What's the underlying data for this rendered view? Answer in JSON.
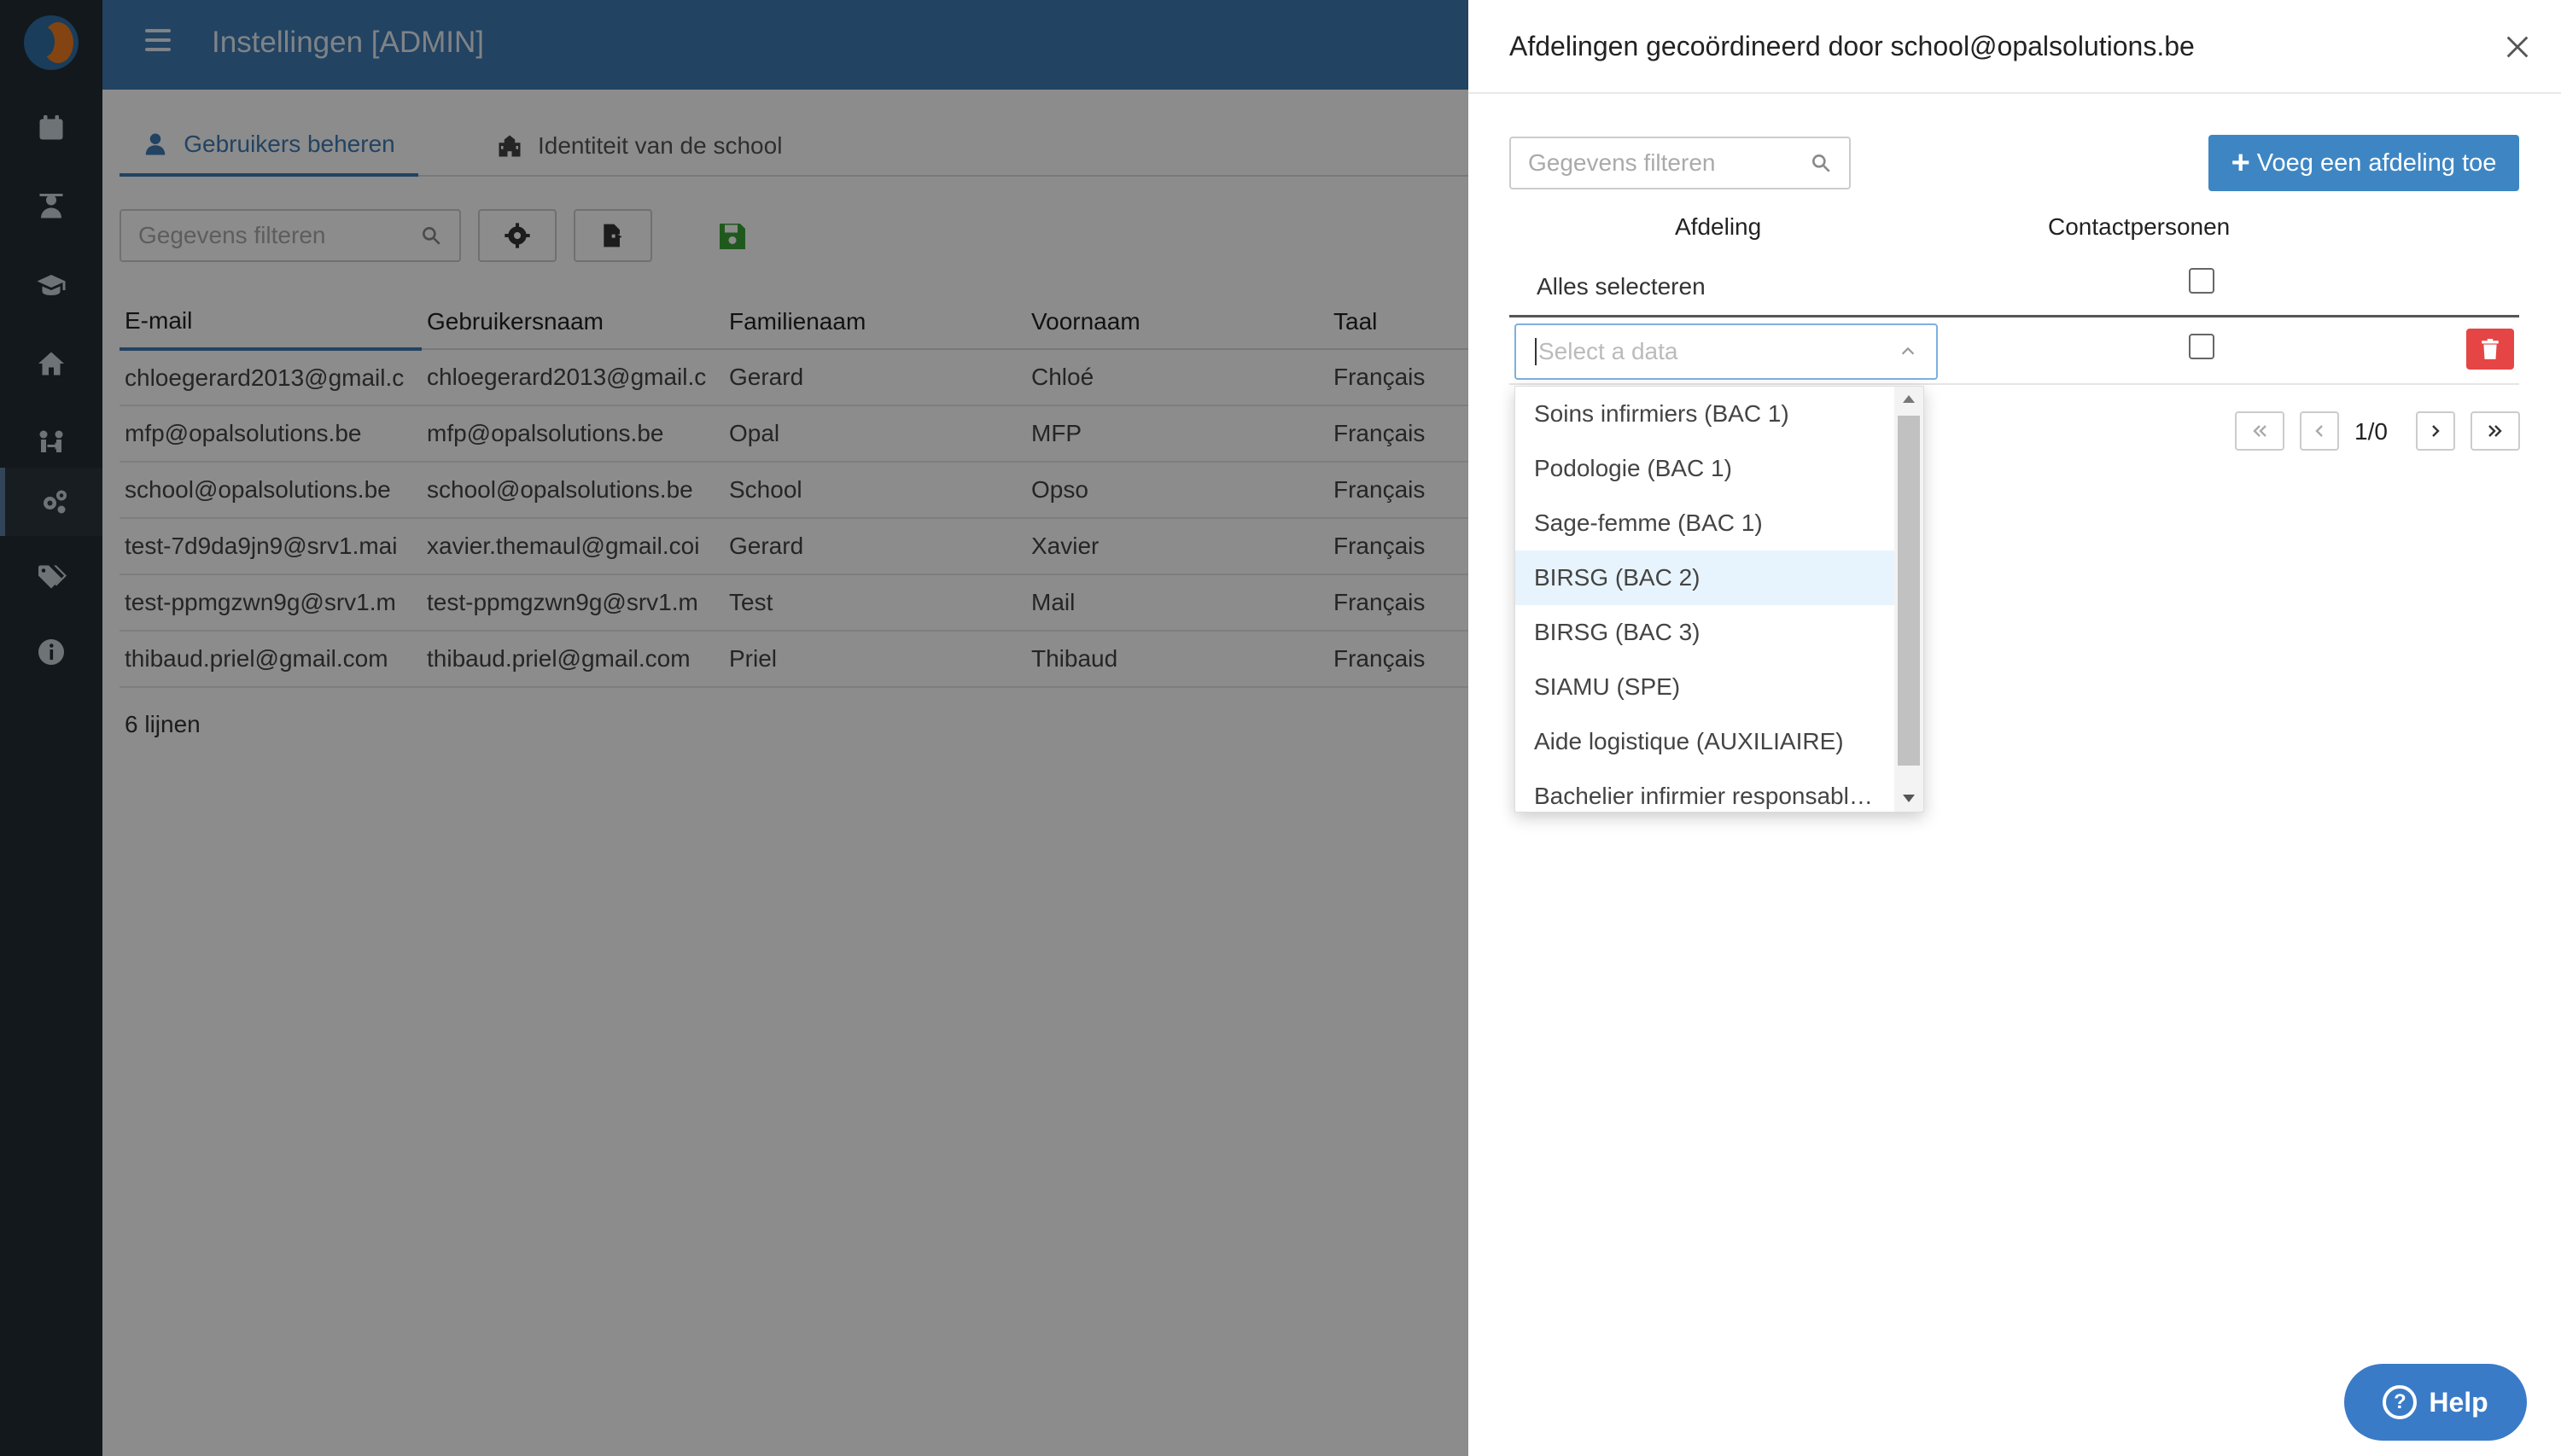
{
  "sidebar": {
    "items": [
      {
        "icon": "calendar-icon"
      },
      {
        "icon": "teacher-icon"
      },
      {
        "icon": "graduation-cap-icon"
      },
      {
        "icon": "home-icon"
      },
      {
        "icon": "users-exchange-icon"
      },
      {
        "icon": "gears-icon",
        "active": true
      },
      {
        "icon": "tags-icon"
      },
      {
        "icon": "info-icon"
      }
    ]
  },
  "header": {
    "title": "Instellingen [ADMIN]"
  },
  "tabs": [
    {
      "label": "Gebruikers beheren",
      "active": true
    },
    {
      "label": "Identiteit van de school",
      "active": false
    }
  ],
  "toolbar": {
    "filter_placeholder": "Gegevens filteren"
  },
  "table": {
    "headers": [
      "E-mail",
      "Gebruikersnaam",
      "Familienaam",
      "Voornaam",
      "Taal"
    ],
    "rows": [
      [
        "chloegerard2013@gmail.c",
        "chloegerard2013@gmail.c",
        "Gerard",
        "Chloé",
        "Français"
      ],
      [
        "mfp@opalsolutions.be",
        "mfp@opalsolutions.be",
        "Opal",
        "MFP",
        "Français"
      ],
      [
        "school@opalsolutions.be",
        "school@opalsolutions.be",
        "School",
        "Opso",
        "Français"
      ],
      [
        "test-7d9da9jn9@srv1.mai",
        "xavier.themaul@gmail.coi",
        "Gerard",
        "Xavier",
        "Français"
      ],
      [
        "test-ppmgzwn9g@srv1.m",
        "test-ppmgzwn9g@srv1.m",
        "Test",
        "Mail",
        "Français"
      ],
      [
        "thibaud.priel@gmail.com",
        "thibaud.priel@gmail.com",
        "Priel",
        "Thibaud",
        "Français"
      ]
    ],
    "count_label": "6 lijnen"
  },
  "drawer": {
    "title": "Afdelingen gecoördineerd door school@opalsolutions.be",
    "filter_placeholder": "Gegevens filteren",
    "add_button": "Voeg een afdeling toe",
    "col_afdeling": "Afdeling",
    "col_contact": "Contactpersonen",
    "select_all": "Alles selecteren",
    "select_placeholder": "Select a data",
    "pager_text": "1/0"
  },
  "dropdown": {
    "options": [
      "Soins infirmiers (BAC 1)",
      "Podologie (BAC 1)",
      "Sage-femme (BAC 1)",
      "BIRSG (BAC 2)",
      "BIRSG (BAC 3)",
      "SIAMU (SPE)",
      "Aide logistique (AUXILIAIRE)",
      "Bachelier infirmier responsabl…"
    ],
    "highlighted": "BIRSG (BAC 2)"
  },
  "help": {
    "label": "Help"
  },
  "colors": {
    "header_blue": "#3e7ab3",
    "sidebar_dark": "#232d33",
    "primary_button": "#3e86c3",
    "danger": "#e64545",
    "help_button": "#3a7bc8"
  }
}
